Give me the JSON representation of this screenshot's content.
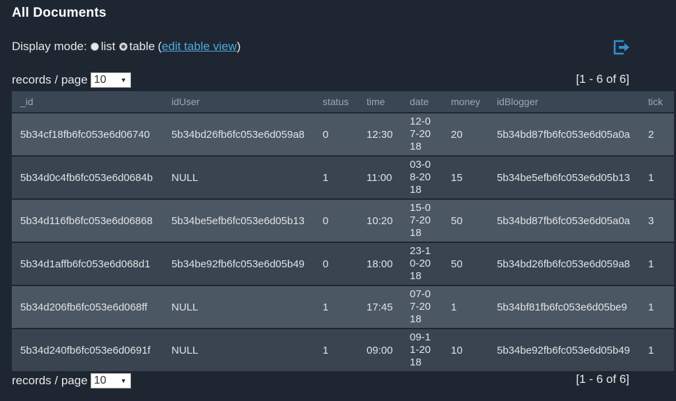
{
  "page": {
    "title": "All Documents",
    "display_mode": {
      "label": "Display mode:",
      "options": [
        "list",
        "table"
      ],
      "selected": "table",
      "open_paren": "(",
      "edit_link": "edit table view",
      "close_paren": ")"
    },
    "pager": {
      "label": "records / page",
      "value": "10",
      "range": "[1 - 6 of 6]"
    }
  },
  "table": {
    "columns": [
      "_id",
      "idUser",
      "status",
      "time",
      "date",
      "money",
      "idBlogger",
      "tick"
    ],
    "rows": [
      [
        "5b34cf18fb6fc053e6d06740",
        "5b34bd26fb6fc053e6d059a8",
        "0",
        "12:30",
        "12-07-2018",
        "20",
        "5b34bd87fb6fc053e6d05a0a",
        "2"
      ],
      [
        "5b34d0c4fb6fc053e6d0684b",
        "NULL",
        "1",
        "11:00",
        "03-08-2018",
        "15",
        "5b34be5efb6fc053e6d05b13",
        "1"
      ],
      [
        "5b34d116fb6fc053e6d06868",
        "5b34be5efb6fc053e6d05b13",
        "0",
        "10:20",
        "15-07-2018",
        "50",
        "5b34bd87fb6fc053e6d05a0a",
        "3"
      ],
      [
        "5b34d1affb6fc053e6d068d1",
        "5b34be92fb6fc053e6d05b49",
        "0",
        "18:00",
        "23-10-2018",
        "50",
        "5b34bd26fb6fc053e6d059a8",
        "1"
      ],
      [
        "5b34d206fb6fc053e6d068ff",
        "NULL",
        "1",
        "17:45",
        "07-07-2018",
        "1",
        "5b34bf81fb6fc053e6d05be9",
        "1"
      ],
      [
        "5b34d240fb6fc053e6d0691f",
        "NULL",
        "1",
        "09:00",
        "09-11-2018",
        "10",
        "5b34be92fb6fc053e6d05b49",
        "1"
      ]
    ]
  },
  "icons": {
    "export": "export-icon"
  },
  "colors": {
    "background": "#1e2731",
    "header_row": "#394654",
    "row_odd": "#4b5763",
    "row_even": "#3a4450",
    "link": "#4fa8e0",
    "icon_accent": "#2f8fd8"
  }
}
